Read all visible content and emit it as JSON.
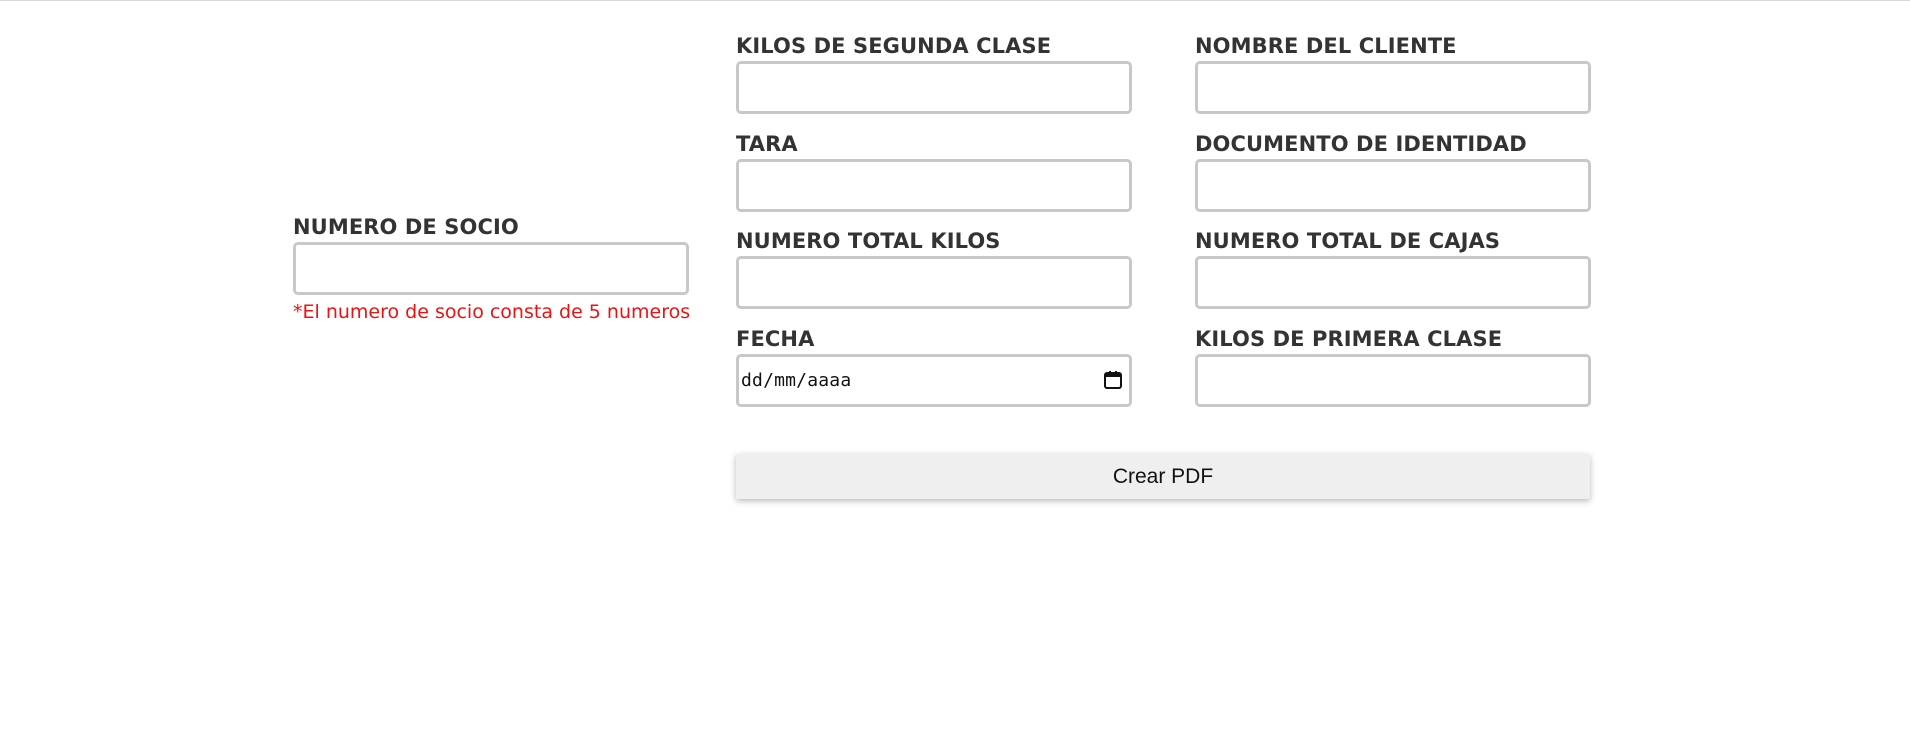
{
  "form": {
    "socio": {
      "label": "NUMERO DE SOCIO",
      "value": "",
      "note": "*El numero de socio consta de 5 numeros"
    },
    "kilos_segunda": {
      "label": "KILOS DE SEGUNDA CLASE",
      "value": ""
    },
    "tara": {
      "label": "TARA",
      "value": ""
    },
    "total_kilos": {
      "label": "NUMERO TOTAL KILOS",
      "value": ""
    },
    "fecha": {
      "label": "FECHA",
      "placeholder": "dd/mm/aaaa",
      "icon": "calendar-icon"
    },
    "cliente": {
      "label": "NOMBRE DEL CLIENTE",
      "value": ""
    },
    "documento": {
      "label": "DOCUMENTO DE IDENTIDAD",
      "value": ""
    },
    "total_cajas": {
      "label": "NUMERO TOTAL DE CAJAS",
      "value": ""
    },
    "kilos_primera": {
      "label": "KILOS DE PRIMERA CLASE",
      "value": ""
    }
  },
  "actions": {
    "create_pdf_label": "Crear PDF"
  },
  "colors": {
    "note": "#ee1111",
    "label": "#333333",
    "input_border": "#c8c8c8",
    "button_bg": "#efefef"
  }
}
